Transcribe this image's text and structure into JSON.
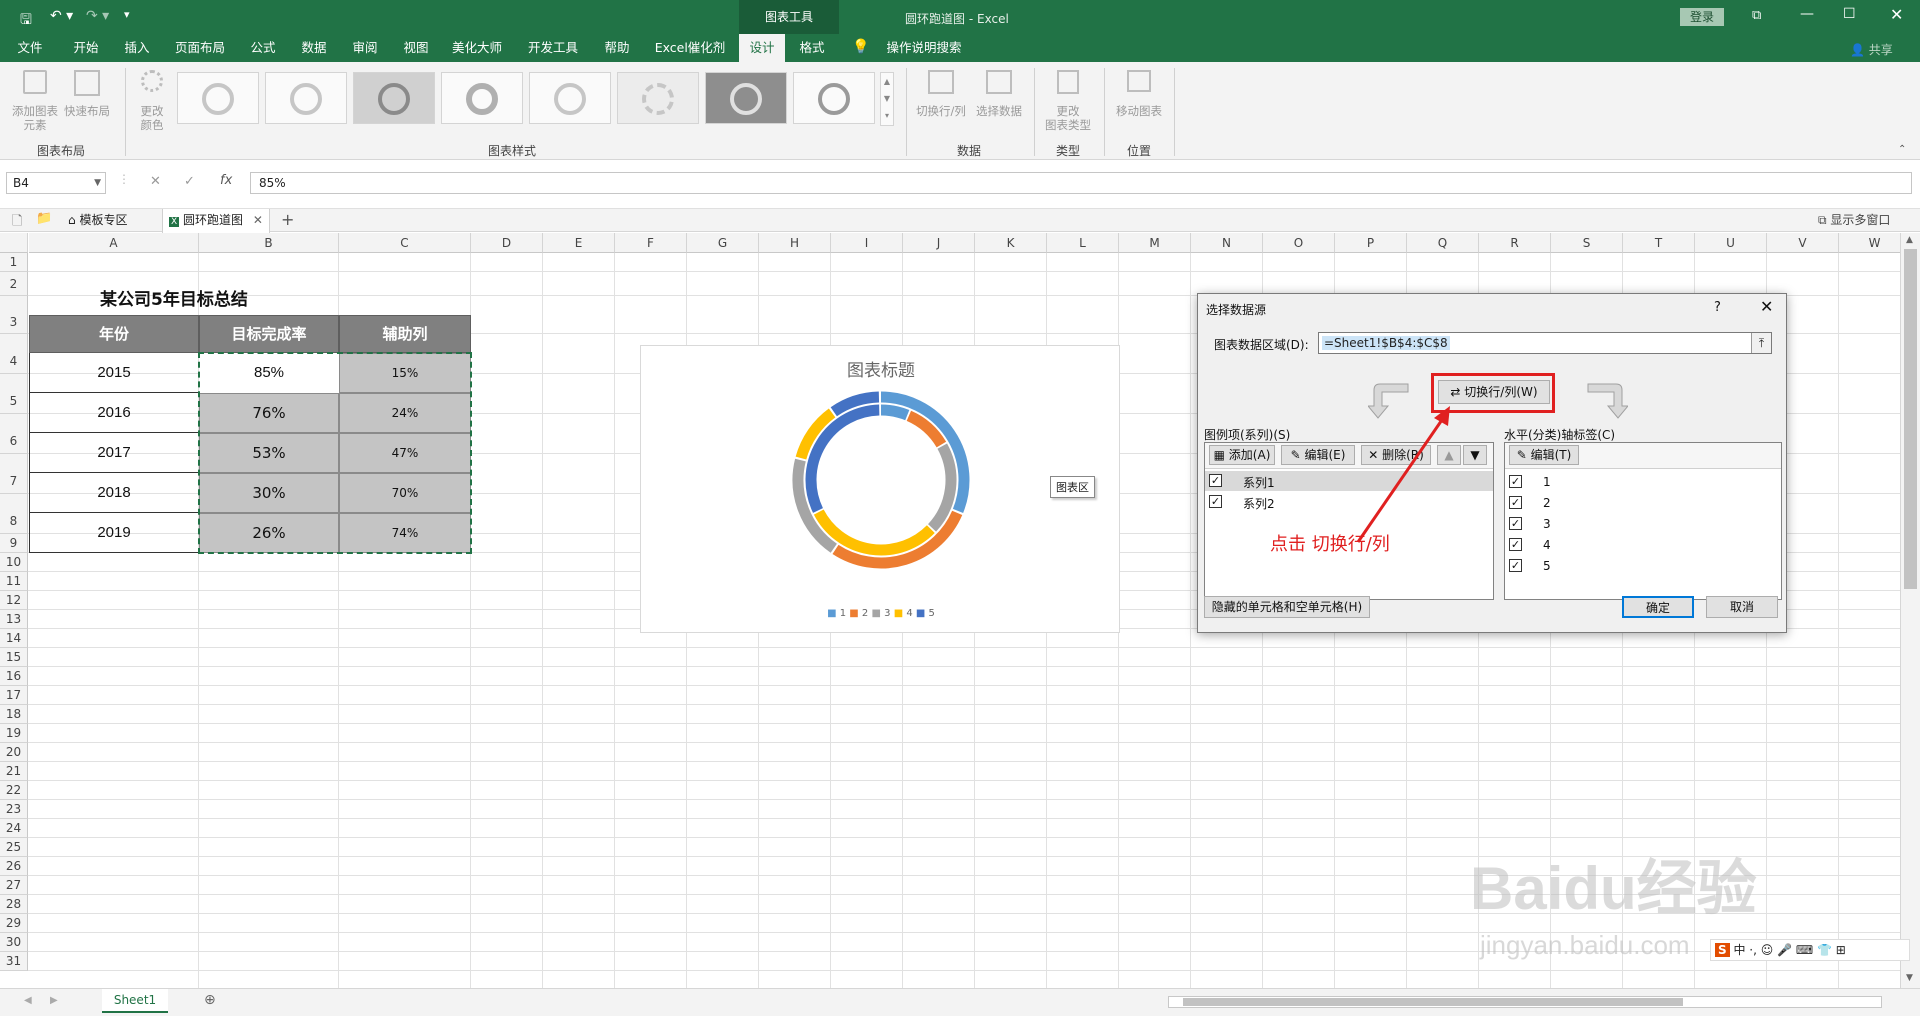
{
  "app": {
    "doc_title": "圆环跑道图",
    "app_name": "Excel",
    "sep": "-",
    "context_tab": "图表工具",
    "login": "登录",
    "share": "共享"
  },
  "menu": {
    "items": [
      "文件",
      "开始",
      "插入",
      "页面布局",
      "公式",
      "数据",
      "审阅",
      "视图",
      "美化大师",
      "开发工具",
      "帮助",
      "Excel催化剂",
      "设计",
      "格式"
    ],
    "active_index": 12,
    "search": "操作说明搜索"
  },
  "ribbon": {
    "add_element": [
      "添加图表",
      "元素"
    ],
    "quick_layout": "快速布局",
    "change_colors": [
      "更改",
      "颜色"
    ],
    "layout_group": "图表布局",
    "styles_group": "图表样式",
    "switch_rowcol": "切换行/列",
    "select_data": "选择数据",
    "data_group": "数据",
    "change_type": [
      "更改",
      "图表类型"
    ],
    "type_group": "类型",
    "move_chart": "移动图表",
    "location_group": "位置"
  },
  "formula_bar": {
    "name_box": "B4",
    "formula": "85%",
    "fx": "fx"
  },
  "doc_tabs": {
    "template_zone": "模板专区",
    "current_file": "圆环跑道图",
    "show_multi": "显示多窗口"
  },
  "sheet": {
    "columns": [
      "A",
      "B",
      "C",
      "D",
      "E",
      "F",
      "G",
      "H",
      "I",
      "J",
      "K",
      "L",
      "M",
      "N",
      "O",
      "P",
      "Q",
      "R",
      "S",
      "T",
      "U",
      "V",
      "W"
    ],
    "rows": [
      "1",
      "2",
      "3",
      "4",
      "5",
      "6",
      "7",
      "8",
      "9",
      "10",
      "11",
      "12",
      "13",
      "14",
      "15",
      "16",
      "17",
      "18",
      "19",
      "20",
      "21",
      "22",
      "23",
      "24",
      "25",
      "26",
      "27",
      "28",
      "29",
      "30",
      "31"
    ],
    "title": "某公司5年目标总结",
    "headers": [
      "年份",
      "目标完成率",
      "辅助列"
    ],
    "data": [
      [
        "2015",
        "85%",
        "15%"
      ],
      [
        "2016",
        "76%",
        "24%"
      ],
      [
        "2017",
        "53%",
        "47%"
      ],
      [
        "2018",
        "30%",
        "70%"
      ],
      [
        "2019",
        "26%",
        "74%"
      ]
    ],
    "tab": "Sheet1"
  },
  "chart": {
    "title": "图表标题",
    "tooltip": "图表区",
    "legend": [
      "1",
      "2",
      "3",
      "4",
      "5"
    ]
  },
  "chart_data": {
    "type": "donut",
    "title": "图表标题",
    "categories": [
      "1",
      "2",
      "3",
      "4",
      "5"
    ],
    "colors": [
      "#5b9bd5",
      "#ed7d31",
      "#a5a5a5",
      "#ffc000",
      "#4472c4"
    ],
    "series": [
      {
        "values": [
          0.85,
          0.76,
          0.53,
          0.3,
          0.26
        ]
      },
      {
        "values": [
          0.15,
          0.24,
          0.47,
          0.7,
          0.74
        ]
      }
    ],
    "legend_position": "bottom"
  },
  "dialog": {
    "title": "选择数据源",
    "help": "?",
    "range_label": "图表数据区域(D):",
    "range_value": "=Sheet1!$B$4:$C$8",
    "switch_button": "切换行/列(W)",
    "legend_label": "图例项(系列)(S)",
    "add": "添加(A)",
    "edit": "编辑(E)",
    "delete": "删除(R)",
    "series": [
      "系列1",
      "系列2"
    ],
    "axis_label": "水平(分类)轴标签(C)",
    "axis_edit": "编辑(T)",
    "axis_items": [
      "1",
      "2",
      "3",
      "4",
      "5"
    ],
    "hidden_cells": "隐藏的单元格和空单元格(H)",
    "ok": "确定",
    "cancel": "取消"
  },
  "annotation": {
    "text": "点击 切换行/列",
    "color": "#e02020"
  },
  "watermark": {
    "brand": "Baidu经验",
    "url": "jingyan.baidu.com"
  }
}
